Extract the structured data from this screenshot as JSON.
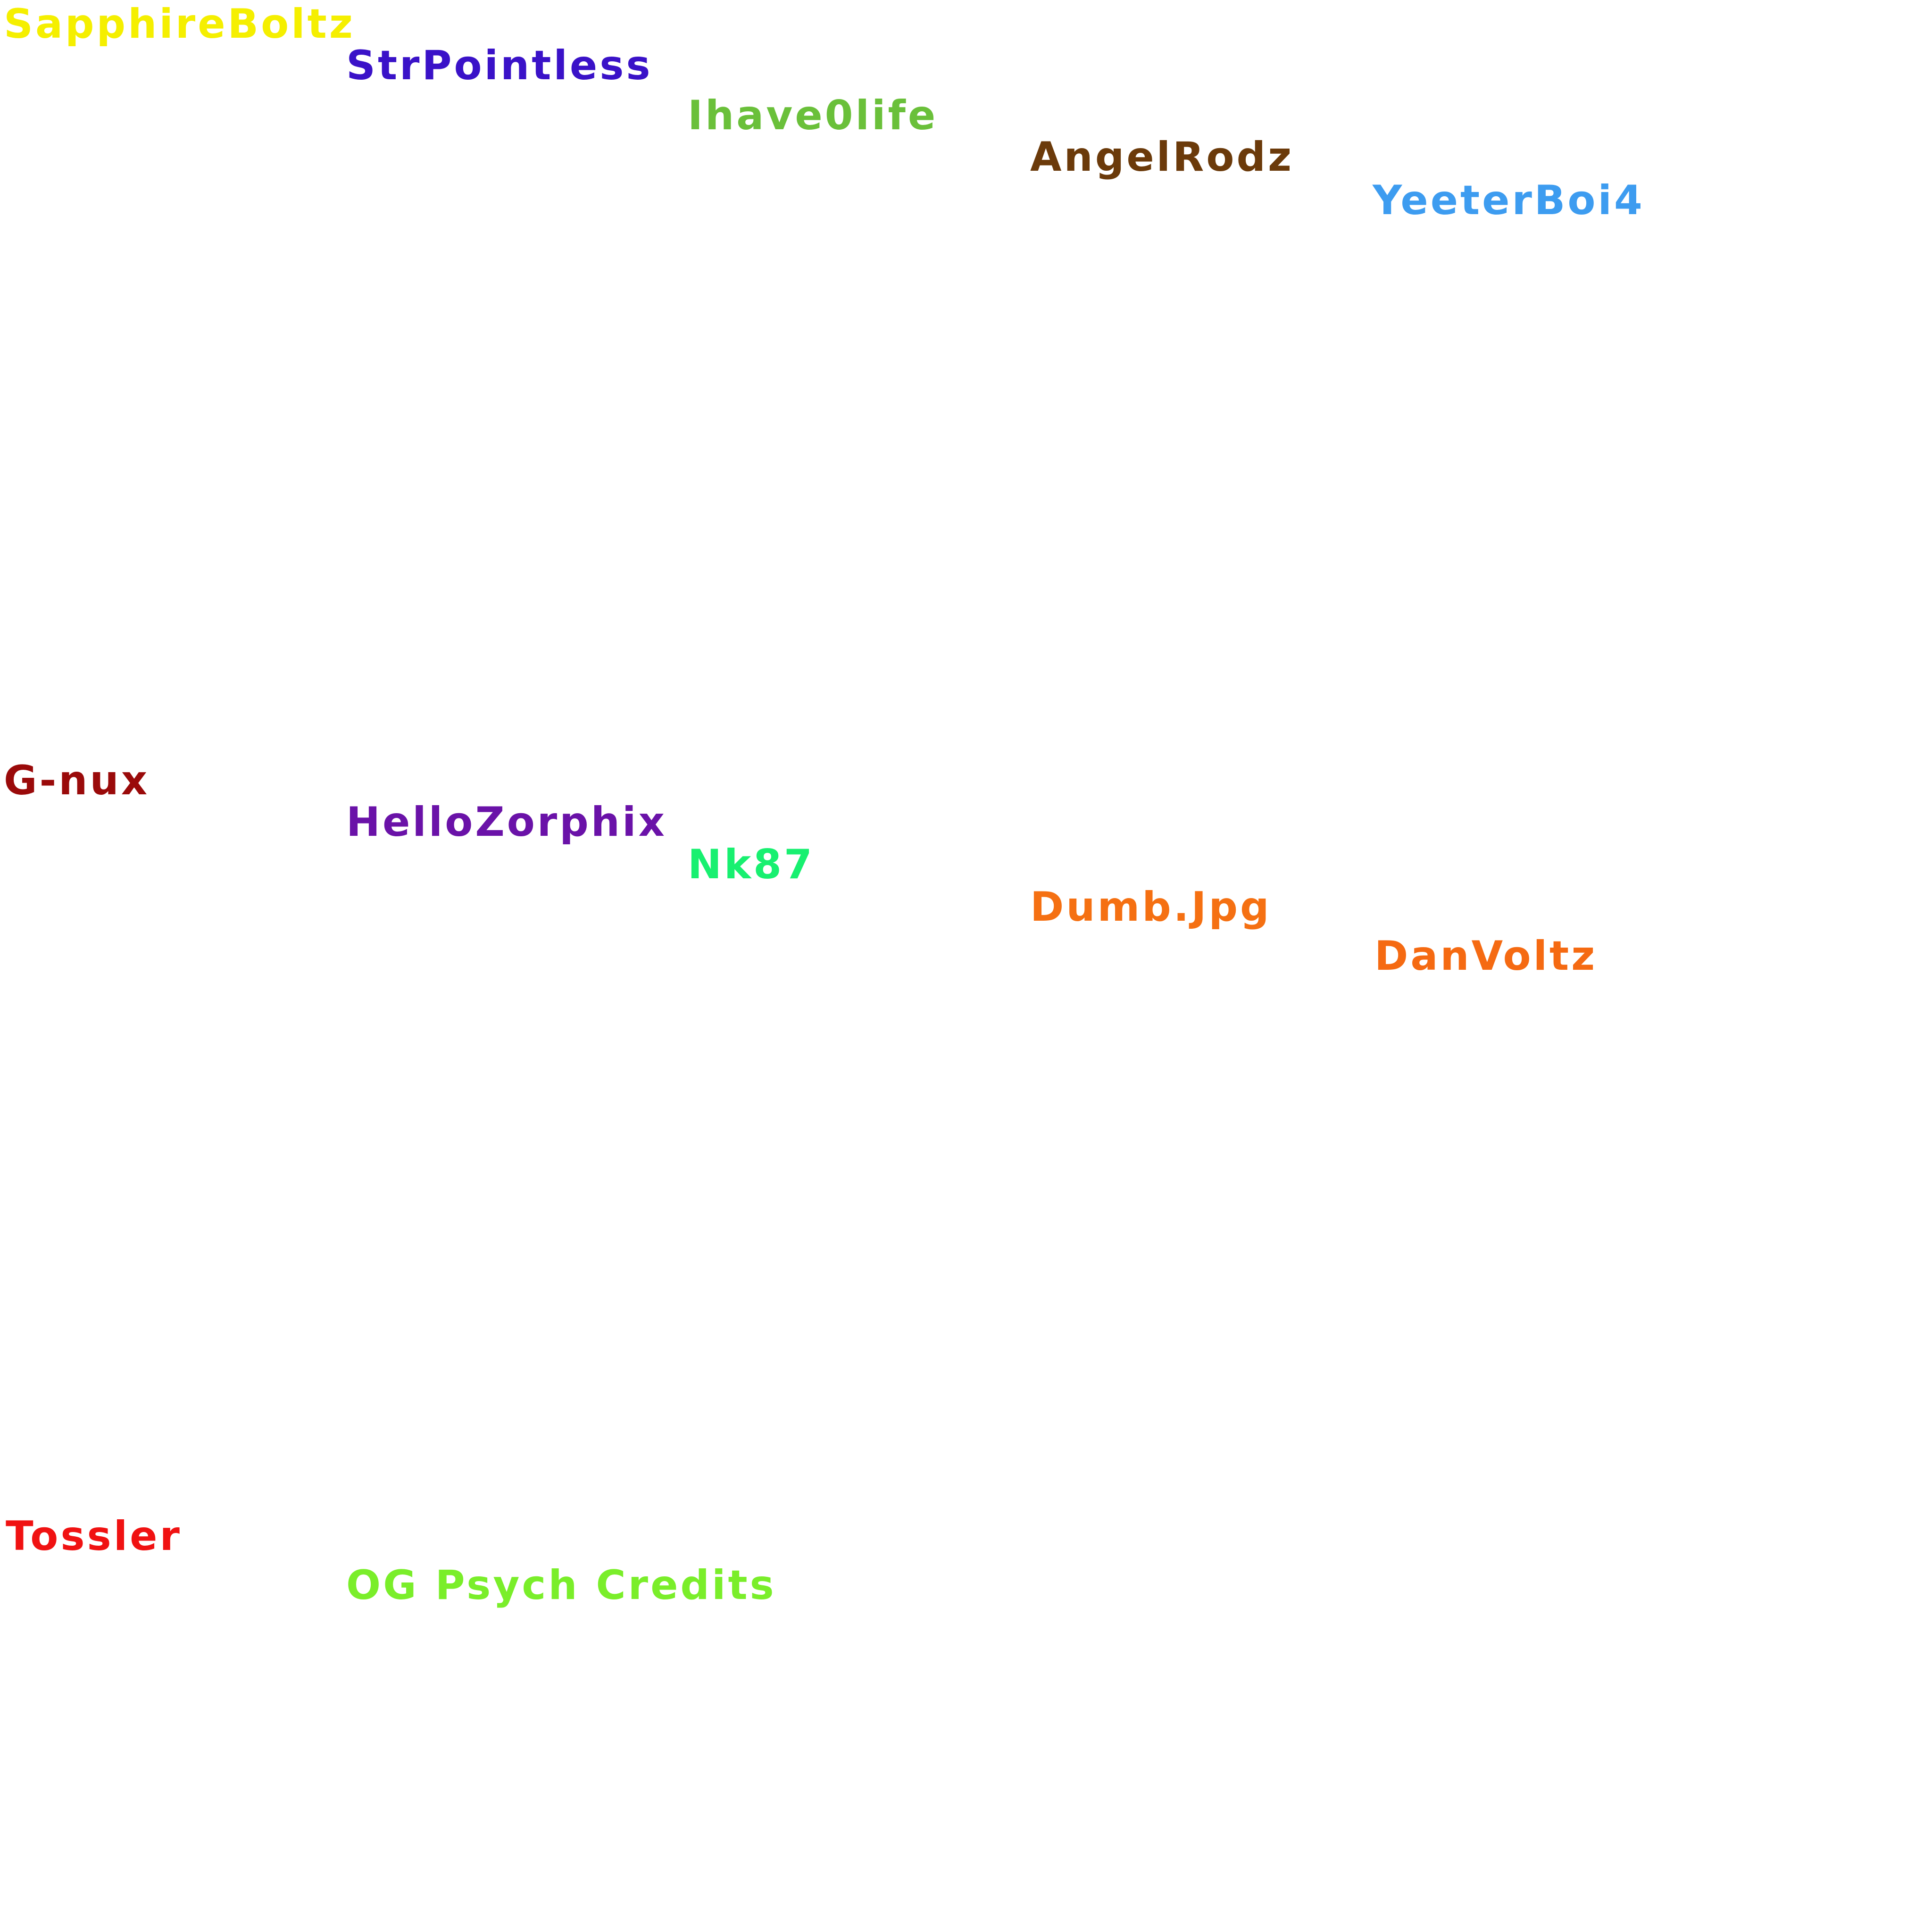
{
  "names": [
    {
      "text": "SapphireBoltz",
      "color": "#f5ef00"
    },
    {
      "text": "StrPointless",
      "color": "#3a12c8"
    },
    {
      "text": "Ihave0life",
      "color": "#6ac03a"
    },
    {
      "text": "AngelRodz",
      "color": "#6b3a0a"
    },
    {
      "text": "YeeterBoi4",
      "color": "#3d9cf0"
    },
    {
      "text": "G-nux",
      "color": "#9a0a0a"
    },
    {
      "text": "HelloZorphix",
      "color": "#6a12a8"
    },
    {
      "text": "Nk87",
      "color": "#18f070"
    },
    {
      "text": "Dumb.Jpg",
      "color": "#f57012"
    },
    {
      "text": "DanVoltz",
      "color": "#f56a12"
    },
    {
      "text": "Tossler",
      "color": "#f01212"
    },
    {
      "text": "OG Psych Credits",
      "color": "#7aee2a"
    }
  ]
}
